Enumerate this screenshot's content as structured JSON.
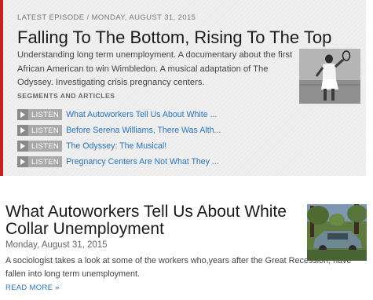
{
  "latest_episode": {
    "eyebrow": "LATEST EPISODE / MONDAY, AUGUST 31, 2015",
    "title": "Falling To The Bottom, Rising To The Top",
    "description": "Understanding long term unemployment. A documentary about the first African American to win Wimbledon. A musical adaptation of The Odyssey. Investigating crisis pregnancy centers.",
    "segments_heading": "SEGMENTS AND ARTICLES",
    "segments": [
      {
        "button": "LISTEN",
        "title": "What Autoworkers Tell Us About White ..."
      },
      {
        "button": "LISTEN",
        "title": "Before Serena Williams, There Was Alth..."
      },
      {
        "button": "LISTEN",
        "title": "The Odyssey: The Musical!"
      },
      {
        "button": "LISTEN",
        "title": "Pregnancy Centers Are Not What They ..."
      }
    ]
  },
  "story": {
    "title": "What Autoworkers Tell Us About White Collar Unemployment",
    "date": "Monday, August 31, 2015",
    "description": "A sociologist takes a look at some of the workers who,years after the Great Recession, have fallen into long term unemployment.",
    "read_more": "READ MORE »"
  },
  "colors": {
    "accent_border": "#c0211f",
    "link": "#2a73b8",
    "listen_button": "#a9a9a9"
  }
}
